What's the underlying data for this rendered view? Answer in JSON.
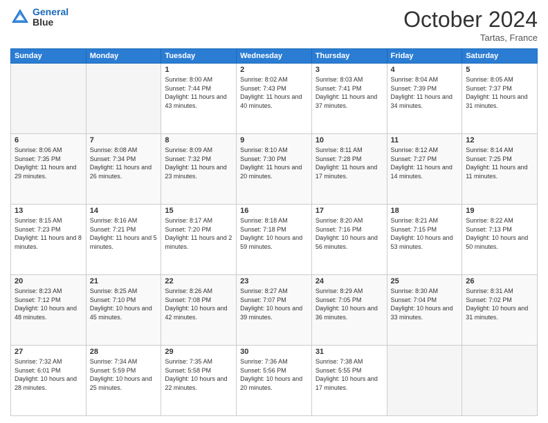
{
  "header": {
    "logo_line1": "General",
    "logo_line2": "Blue",
    "month": "October 2024",
    "location": "Tartas, France"
  },
  "weekdays": [
    "Sunday",
    "Monday",
    "Tuesday",
    "Wednesday",
    "Thursday",
    "Friday",
    "Saturday"
  ],
  "weeks": [
    [
      {
        "day": "",
        "info": ""
      },
      {
        "day": "",
        "info": ""
      },
      {
        "day": "1",
        "info": "Sunrise: 8:00 AM\nSunset: 7:44 PM\nDaylight: 11 hours and 43 minutes."
      },
      {
        "day": "2",
        "info": "Sunrise: 8:02 AM\nSunset: 7:43 PM\nDaylight: 11 hours and 40 minutes."
      },
      {
        "day": "3",
        "info": "Sunrise: 8:03 AM\nSunset: 7:41 PM\nDaylight: 11 hours and 37 minutes."
      },
      {
        "day": "4",
        "info": "Sunrise: 8:04 AM\nSunset: 7:39 PM\nDaylight: 11 hours and 34 minutes."
      },
      {
        "day": "5",
        "info": "Sunrise: 8:05 AM\nSunset: 7:37 PM\nDaylight: 11 hours and 31 minutes."
      }
    ],
    [
      {
        "day": "6",
        "info": "Sunrise: 8:06 AM\nSunset: 7:35 PM\nDaylight: 11 hours and 29 minutes."
      },
      {
        "day": "7",
        "info": "Sunrise: 8:08 AM\nSunset: 7:34 PM\nDaylight: 11 hours and 26 minutes."
      },
      {
        "day": "8",
        "info": "Sunrise: 8:09 AM\nSunset: 7:32 PM\nDaylight: 11 hours and 23 minutes."
      },
      {
        "day": "9",
        "info": "Sunrise: 8:10 AM\nSunset: 7:30 PM\nDaylight: 11 hours and 20 minutes."
      },
      {
        "day": "10",
        "info": "Sunrise: 8:11 AM\nSunset: 7:28 PM\nDaylight: 11 hours and 17 minutes."
      },
      {
        "day": "11",
        "info": "Sunrise: 8:12 AM\nSunset: 7:27 PM\nDaylight: 11 hours and 14 minutes."
      },
      {
        "day": "12",
        "info": "Sunrise: 8:14 AM\nSunset: 7:25 PM\nDaylight: 11 hours and 11 minutes."
      }
    ],
    [
      {
        "day": "13",
        "info": "Sunrise: 8:15 AM\nSunset: 7:23 PM\nDaylight: 11 hours and 8 minutes."
      },
      {
        "day": "14",
        "info": "Sunrise: 8:16 AM\nSunset: 7:21 PM\nDaylight: 11 hours and 5 minutes."
      },
      {
        "day": "15",
        "info": "Sunrise: 8:17 AM\nSunset: 7:20 PM\nDaylight: 11 hours and 2 minutes."
      },
      {
        "day": "16",
        "info": "Sunrise: 8:18 AM\nSunset: 7:18 PM\nDaylight: 10 hours and 59 minutes."
      },
      {
        "day": "17",
        "info": "Sunrise: 8:20 AM\nSunset: 7:16 PM\nDaylight: 10 hours and 56 minutes."
      },
      {
        "day": "18",
        "info": "Sunrise: 8:21 AM\nSunset: 7:15 PM\nDaylight: 10 hours and 53 minutes."
      },
      {
        "day": "19",
        "info": "Sunrise: 8:22 AM\nSunset: 7:13 PM\nDaylight: 10 hours and 50 minutes."
      }
    ],
    [
      {
        "day": "20",
        "info": "Sunrise: 8:23 AM\nSunset: 7:12 PM\nDaylight: 10 hours and 48 minutes."
      },
      {
        "day": "21",
        "info": "Sunrise: 8:25 AM\nSunset: 7:10 PM\nDaylight: 10 hours and 45 minutes."
      },
      {
        "day": "22",
        "info": "Sunrise: 8:26 AM\nSunset: 7:08 PM\nDaylight: 10 hours and 42 minutes."
      },
      {
        "day": "23",
        "info": "Sunrise: 8:27 AM\nSunset: 7:07 PM\nDaylight: 10 hours and 39 minutes."
      },
      {
        "day": "24",
        "info": "Sunrise: 8:29 AM\nSunset: 7:05 PM\nDaylight: 10 hours and 36 minutes."
      },
      {
        "day": "25",
        "info": "Sunrise: 8:30 AM\nSunset: 7:04 PM\nDaylight: 10 hours and 33 minutes."
      },
      {
        "day": "26",
        "info": "Sunrise: 8:31 AM\nSunset: 7:02 PM\nDaylight: 10 hours and 31 minutes."
      }
    ],
    [
      {
        "day": "27",
        "info": "Sunrise: 7:32 AM\nSunset: 6:01 PM\nDaylight: 10 hours and 28 minutes."
      },
      {
        "day": "28",
        "info": "Sunrise: 7:34 AM\nSunset: 5:59 PM\nDaylight: 10 hours and 25 minutes."
      },
      {
        "day": "29",
        "info": "Sunrise: 7:35 AM\nSunset: 5:58 PM\nDaylight: 10 hours and 22 minutes."
      },
      {
        "day": "30",
        "info": "Sunrise: 7:36 AM\nSunset: 5:56 PM\nDaylight: 10 hours and 20 minutes."
      },
      {
        "day": "31",
        "info": "Sunrise: 7:38 AM\nSunset: 5:55 PM\nDaylight: 10 hours and 17 minutes."
      },
      {
        "day": "",
        "info": ""
      },
      {
        "day": "",
        "info": ""
      }
    ]
  ]
}
